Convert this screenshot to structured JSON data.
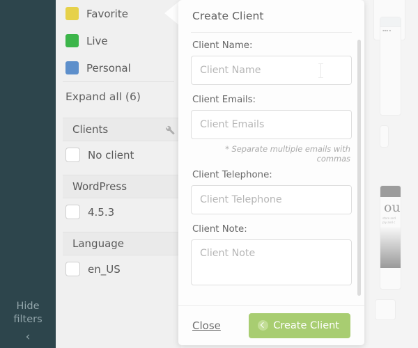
{
  "rail": {
    "hide_line1": "Hide",
    "hide_line2": "filters",
    "collapse_icon": "chevron-left-icon",
    "chevron": "‹"
  },
  "filters": {
    "labels": [
      {
        "text": "Favorite",
        "color": "#e6d14a"
      },
      {
        "text": "Live",
        "color": "#3cb54a"
      },
      {
        "text": "Personal",
        "color": "#5d8fcb"
      }
    ],
    "expand_all": "Expand all (6)",
    "groups": [
      {
        "title": "Clients",
        "tool_icon": "wrench-icon",
        "options": [
          "No client"
        ]
      },
      {
        "title": "WordPress",
        "options": [
          "4.5.3"
        ]
      },
      {
        "title": "Language",
        "options": [
          "en_US"
        ]
      }
    ]
  },
  "modal": {
    "title": "Create Client",
    "scrollbar": "modal-scrollbar",
    "fields": [
      {
        "label": "Client Name:",
        "placeholder": "Client Name",
        "value": "",
        "type": "text",
        "focused": true
      },
      {
        "label": "Client Emails:",
        "placeholder": "Client Emails",
        "value": "",
        "type": "text",
        "hint": "* Separate multiple emails with commas"
      },
      {
        "label": "Client Telephone:",
        "placeholder": "Client Telephone",
        "value": "",
        "type": "text"
      },
      {
        "label": "Client Note:",
        "placeholder": "Client Note",
        "value": "",
        "type": "textarea"
      }
    ],
    "close_label": "Close",
    "create_label": "Create Client",
    "create_icon": "circle-arrow-icon",
    "accent_color": "#a8cd71"
  },
  "background": {
    "thumb_caption": "ou"
  }
}
